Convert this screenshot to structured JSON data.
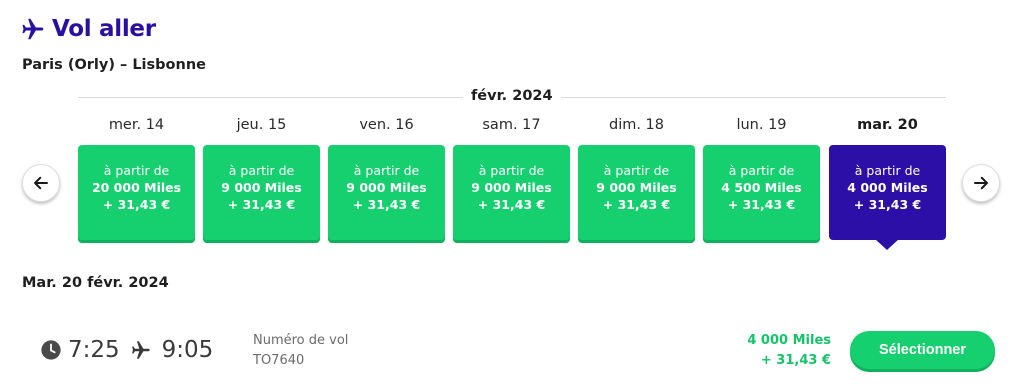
{
  "header": {
    "title": "Vol aller",
    "route": "Paris (Orly) – Lisbonne"
  },
  "calendar": {
    "month": "févr. 2024",
    "days": [
      {
        "label": "mer. 14",
        "from": "à partir de",
        "miles": "20 000 Miles",
        "price": "+ 31,43 €",
        "selected": false
      },
      {
        "label": "jeu. 15",
        "from": "à partir de",
        "miles": "9 000 Miles",
        "price": "+ 31,43 €",
        "selected": false
      },
      {
        "label": "ven. 16",
        "from": "à partir de",
        "miles": "9 000 Miles",
        "price": "+ 31,43 €",
        "selected": false
      },
      {
        "label": "sam. 17",
        "from": "à partir de",
        "miles": "9 000 Miles",
        "price": "+ 31,43 €",
        "selected": false
      },
      {
        "label": "dim. 18",
        "from": "à partir de",
        "miles": "9 000 Miles",
        "price": "+ 31,43 €",
        "selected": false
      },
      {
        "label": "lun. 19",
        "from": "à partir de",
        "miles": "4 500 Miles",
        "price": "+ 31,43 €",
        "selected": false
      },
      {
        "label": "mar. 20",
        "from": "à partir de",
        "miles": "4 000 Miles",
        "price": "+ 31,43 €",
        "selected": true
      }
    ]
  },
  "icons": {
    "title": "plane-icon",
    "prev": "arrow-left-icon",
    "next": "arrow-right-icon",
    "departure": "clock-icon",
    "arrival": "plane-icon"
  },
  "results": {
    "date_heading": "Mar. 20 févr. 2024",
    "flights": [
      {
        "departure": "7:25",
        "arrival": "9:05",
        "flight_number_label": "Numéro de vol",
        "flight_number": "TO7640",
        "miles": "4 000 Miles",
        "price": "+ 31,43 €",
        "select_label": "Sélectionner"
      }
    ]
  },
  "colors": {
    "brand": "#2a0fa0",
    "accent_green": "#16d06f",
    "selected_card": "#2b0fa6"
  }
}
